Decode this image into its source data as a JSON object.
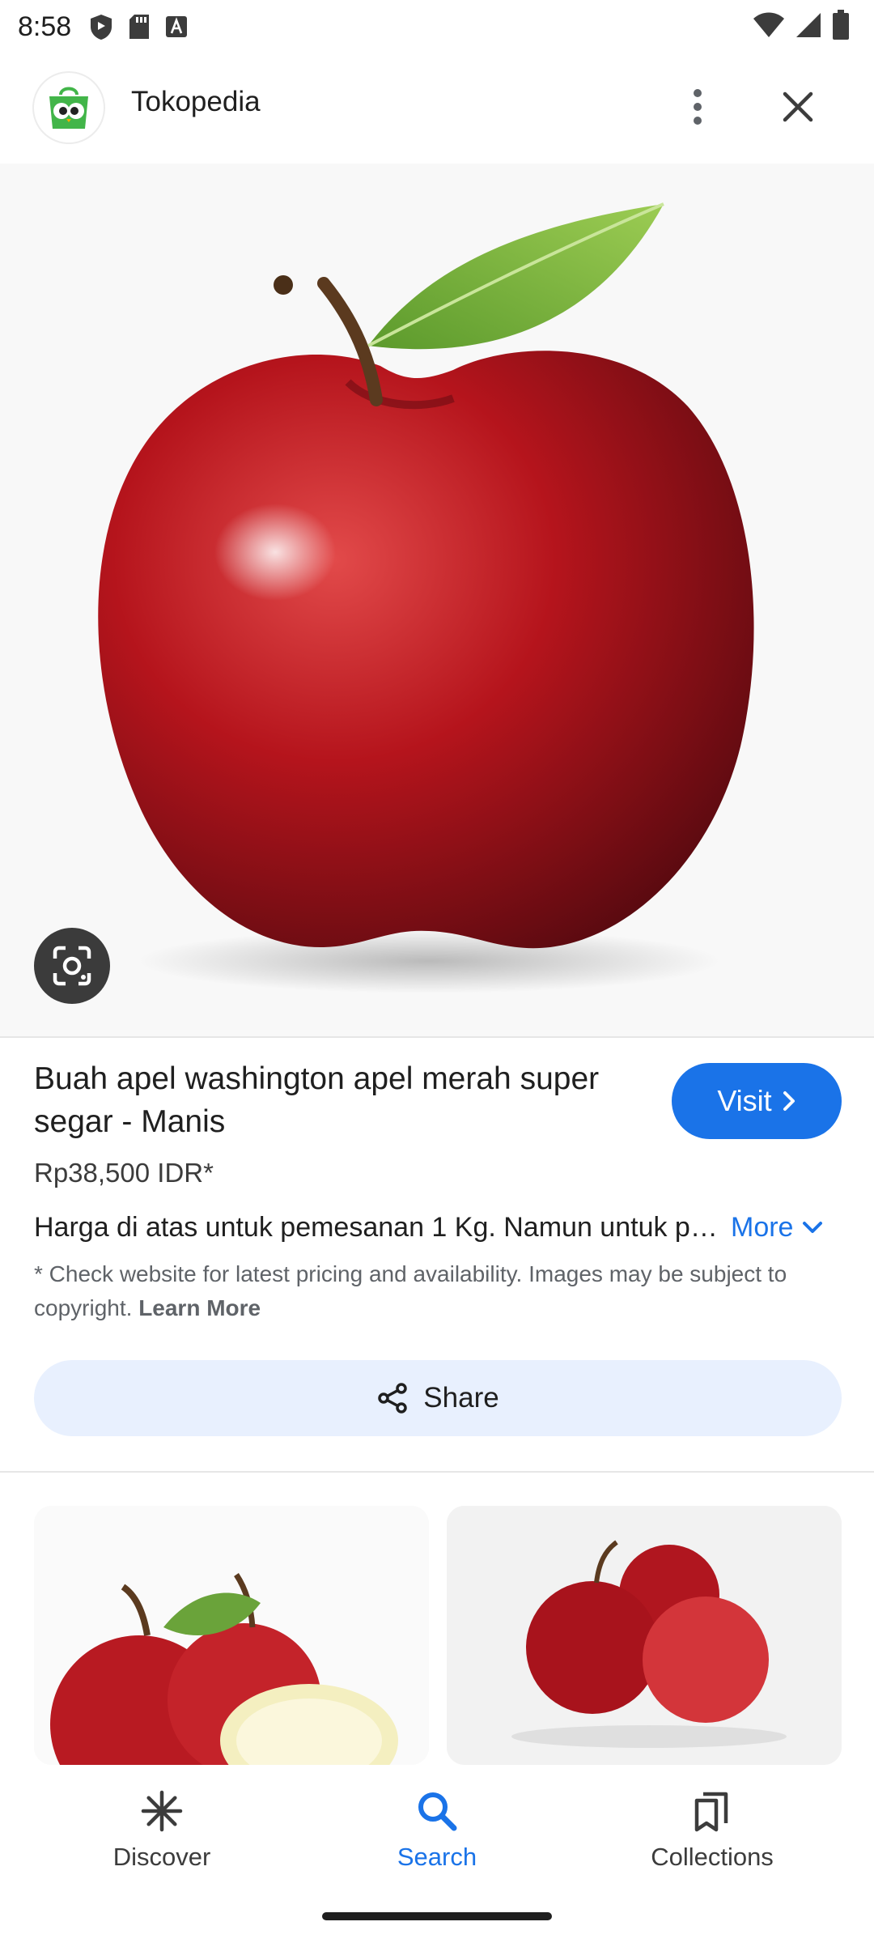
{
  "status_bar": {
    "time": "8:58",
    "left_icons": [
      "shield-icon",
      "sd-card-icon",
      "font-a-icon"
    ],
    "right_icons": [
      "wifi-icon",
      "signal-icon",
      "battery-icon"
    ]
  },
  "header": {
    "site_name": "Tokopedia",
    "logo_icon": "tokopedia-logo-icon",
    "menu_icon": "more-vert-icon",
    "close_icon": "close-icon"
  },
  "product": {
    "title": "Buah apel washington apel merah super segar - Manis",
    "visit_label": "Visit",
    "price": "Rp38,500 IDR*",
    "description": "Harga di atas untuk pemesanan 1 Kg. Namun untuk pemesanan",
    "more_label": "More",
    "disclaimer": "* Check website for latest pricing and availability. Images may be subject to copyright.",
    "learn_more": "Learn More",
    "share_label": "Share"
  },
  "colors": {
    "accent": "#1a73e8",
    "share_bg": "#e8f0fe"
  },
  "bottom_nav": {
    "items": [
      {
        "label": "Discover",
        "icon": "asterisk-icon",
        "active": false
      },
      {
        "label": "Search",
        "icon": "search-icon",
        "active": true
      },
      {
        "label": "Collections",
        "icon": "collections-icon",
        "active": false
      }
    ]
  }
}
